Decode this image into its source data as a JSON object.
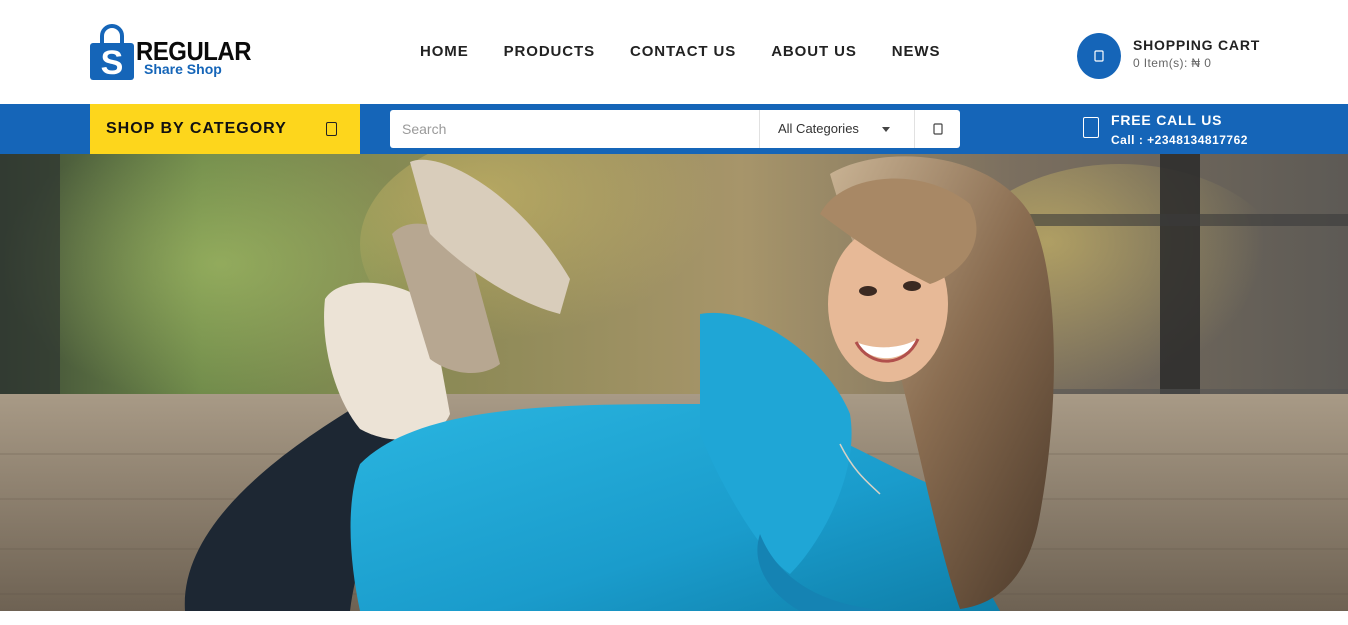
{
  "brand": {
    "logo_letter": "S",
    "name_main": "REGULAR",
    "name_sub": "Share Shop",
    "primary_color": "#1565b8",
    "accent_color": "#fdd61c"
  },
  "nav": {
    "items": [
      {
        "label": "HOME"
      },
      {
        "label": "PRODUCTS"
      },
      {
        "label": "CONTACT US"
      },
      {
        "label": "ABOUT US"
      },
      {
        "label": "NEWS"
      }
    ]
  },
  "cart": {
    "icon": "shopping-cart-icon",
    "title": "SHOPPING CART",
    "summary": "0 Item(s): ₦ 0"
  },
  "category_menu": {
    "label": "SHOP BY CATEGORY",
    "icon": "menu-icon"
  },
  "search": {
    "placeholder": "Search",
    "value": "",
    "category_selected": "All Categories",
    "button_icon": "search-icon"
  },
  "call": {
    "icon": "phone-icon",
    "title": "FREE CALL US",
    "number": "Call : +2348134817762"
  },
  "hero": {
    "image": "hero-banner-image"
  }
}
